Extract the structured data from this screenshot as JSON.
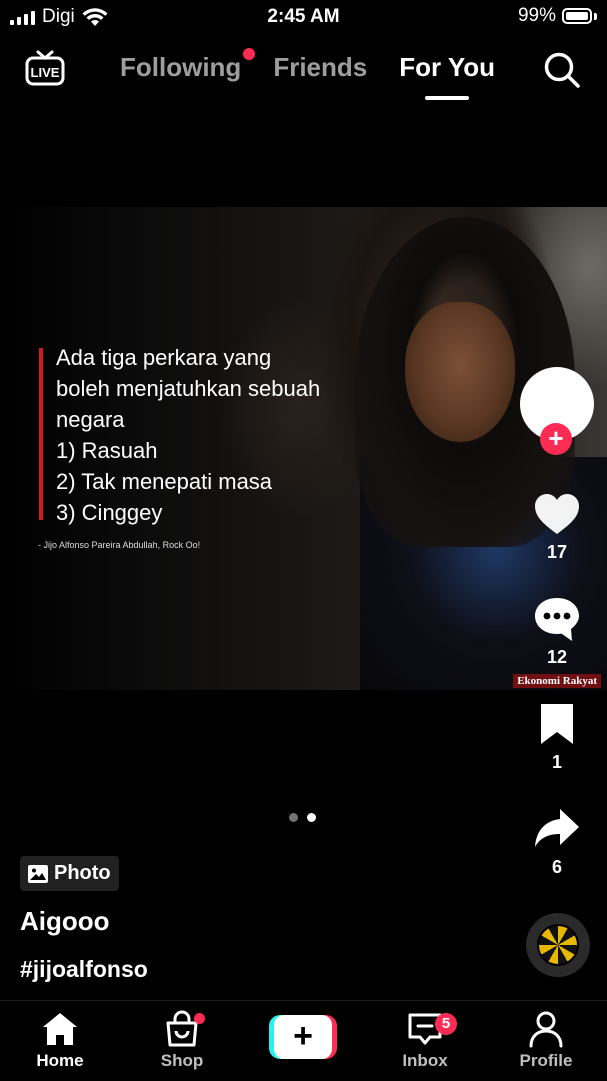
{
  "status_bar": {
    "carrier": "Digi",
    "time": "2:45 AM",
    "battery": "99%"
  },
  "top_nav": {
    "live_label": "LIVE",
    "tabs": [
      {
        "label": "Following",
        "has_dot": true
      },
      {
        "label": "Friends"
      },
      {
        "label": "For You",
        "active": true
      }
    ]
  },
  "post": {
    "quote_lines": [
      "Ada tiga perkara yang",
      "boleh menjatuhkan sebuah",
      "negara",
      "1) Rasuah",
      "2) Tak menepati masa",
      "3) Cinggey"
    ],
    "attribution": "- Jijo Alfonso Pareira Abdullah, Rock Oo!",
    "watermark": "Ekonomi Rakyat",
    "carousel": {
      "total": 2,
      "current": 2
    }
  },
  "actions": {
    "likes": "17",
    "comments": "12",
    "saves": "1",
    "shares": "6"
  },
  "caption": {
    "badge": "Photo",
    "username": "Aigooo",
    "hashtag": "#jijoalfonso"
  },
  "bottom_nav": {
    "home": "Home",
    "shop": "Shop",
    "inbox": "Inbox",
    "inbox_badge": "5",
    "profile": "Profile"
  },
  "colors": {
    "accent": "#fe2c55",
    "cyan": "#25f4ee"
  }
}
